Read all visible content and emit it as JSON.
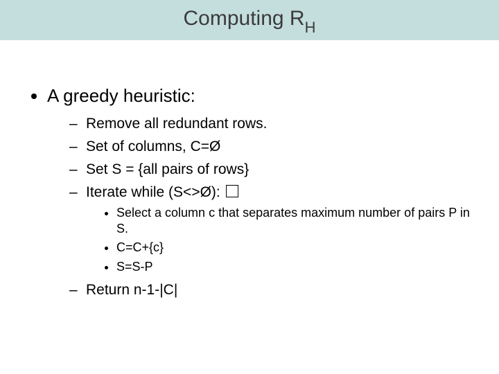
{
  "title_main": "Computing R",
  "title_sub": "H",
  "lvl1_item": "A greedy heuristic:",
  "lvl2": [
    "Remove all redundant rows.",
    "Set of columns, C=Ø",
    "Set S = {all pairs of rows}",
    "Iterate while (S<>Ø): "
  ],
  "lvl3": [
    "Select a column c that separates maximum number of pairs P in S.",
    "C=C+{c}",
    "S=S-P"
  ],
  "lvl2_tail": "Return n-1-|C|"
}
